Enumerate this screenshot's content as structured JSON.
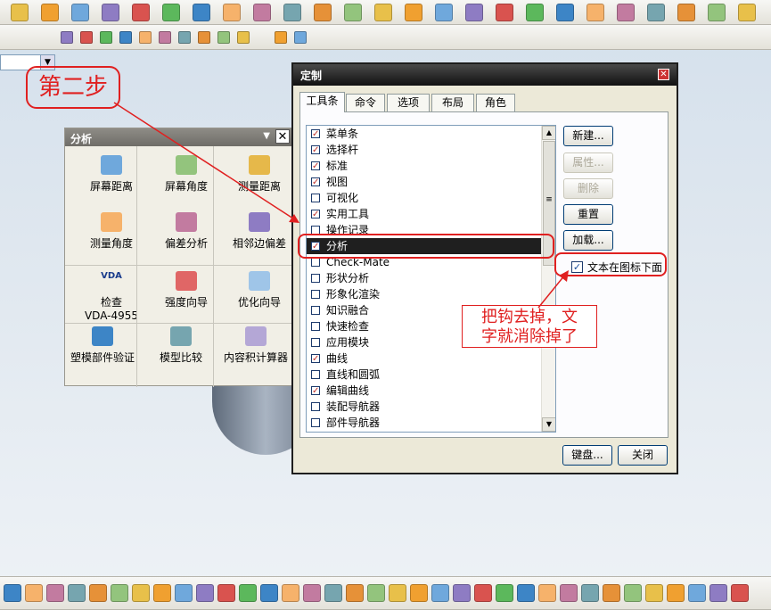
{
  "toolbar_top": {
    "icons": [
      "shaded-face-icon",
      "block-icon",
      "cylinder-icon",
      "pattern-icon",
      "sweep-icon",
      "surface-icon",
      "box-icon",
      "assembly-icon",
      "sheet-icon",
      "feature-icon",
      "extrude-icon",
      "mesh-icon",
      "curve-icon",
      "plane-icon",
      "trim-icon",
      "point-icon",
      "blend-icon",
      "analysis-icon",
      "measure-icon",
      "wave-icon",
      "tube-icon",
      "frame-icon",
      "cube-icon",
      "yellow-cube-icon",
      "orange-cube-icon"
    ]
  },
  "toolbar_second": {
    "combo_value": ""
  },
  "analysis_panel": {
    "title": "分析",
    "tools": [
      {
        "label": "屏幕距离"
      },
      {
        "label": "屏幕角度"
      },
      {
        "label": "测量距离"
      },
      {
        "label": "测量角度"
      },
      {
        "label": "偏差分析"
      },
      {
        "label": "相邻边偏差"
      },
      {
        "label": "检查\nVDA-4955",
        "line1": "检查",
        "line2": "VDA-4955",
        "icon_text": "VDA"
      },
      {
        "label": "强度向导"
      },
      {
        "label": "优化向导"
      },
      {
        "label": "塑模部件验证"
      },
      {
        "label": "模型比较"
      },
      {
        "label": "内容积计算器"
      }
    ]
  },
  "dialog": {
    "title": "定制",
    "close_glyph": "✕",
    "tabs": [
      "工具条",
      "命令",
      "选项",
      "布局",
      "角色"
    ],
    "active_tab": "工具条",
    "list_items": [
      {
        "label": "菜单条",
        "checked": true
      },
      {
        "label": "选择杆",
        "checked": true
      },
      {
        "label": "标准",
        "checked": true
      },
      {
        "label": "视图",
        "checked": true
      },
      {
        "label": "可视化",
        "checked": false
      },
      {
        "label": "实用工具",
        "checked": true
      },
      {
        "label": "操作记录",
        "checked": false
      },
      {
        "label": "分析",
        "checked": true,
        "selected": true
      },
      {
        "label": "Check-Mate",
        "checked": false
      },
      {
        "label": "形状分析",
        "checked": false
      },
      {
        "label": "形象化渲染",
        "checked": false
      },
      {
        "label": "知识融合",
        "checked": false
      },
      {
        "label": "快速检查",
        "checked": false
      },
      {
        "label": "应用模块",
        "checked": false
      },
      {
        "label": "曲线",
        "checked": true
      },
      {
        "label": "直线和圆弧",
        "checked": false
      },
      {
        "label": "编辑曲线",
        "checked": true
      },
      {
        "label": "装配导航器",
        "checked": false
      },
      {
        "label": "部件导航器",
        "checked": false
      }
    ],
    "buttons": {
      "new": "新建...",
      "properties": "属性...",
      "delete": "删除",
      "reset": "重置",
      "load": "加载..."
    },
    "text_below_icon": {
      "label": "文本在图标下面",
      "checked": true
    },
    "footer": {
      "keyboard": "键盘...",
      "close": "关闭"
    }
  },
  "annotations": {
    "step": "第二步",
    "note_line1": "把钩去掉，文",
    "note_line2": "字就消除掉了"
  },
  "colors": {
    "annotation": "#e02020",
    "title_bar": "#1e1e1e",
    "selected_row": "#1f1f1f"
  }
}
